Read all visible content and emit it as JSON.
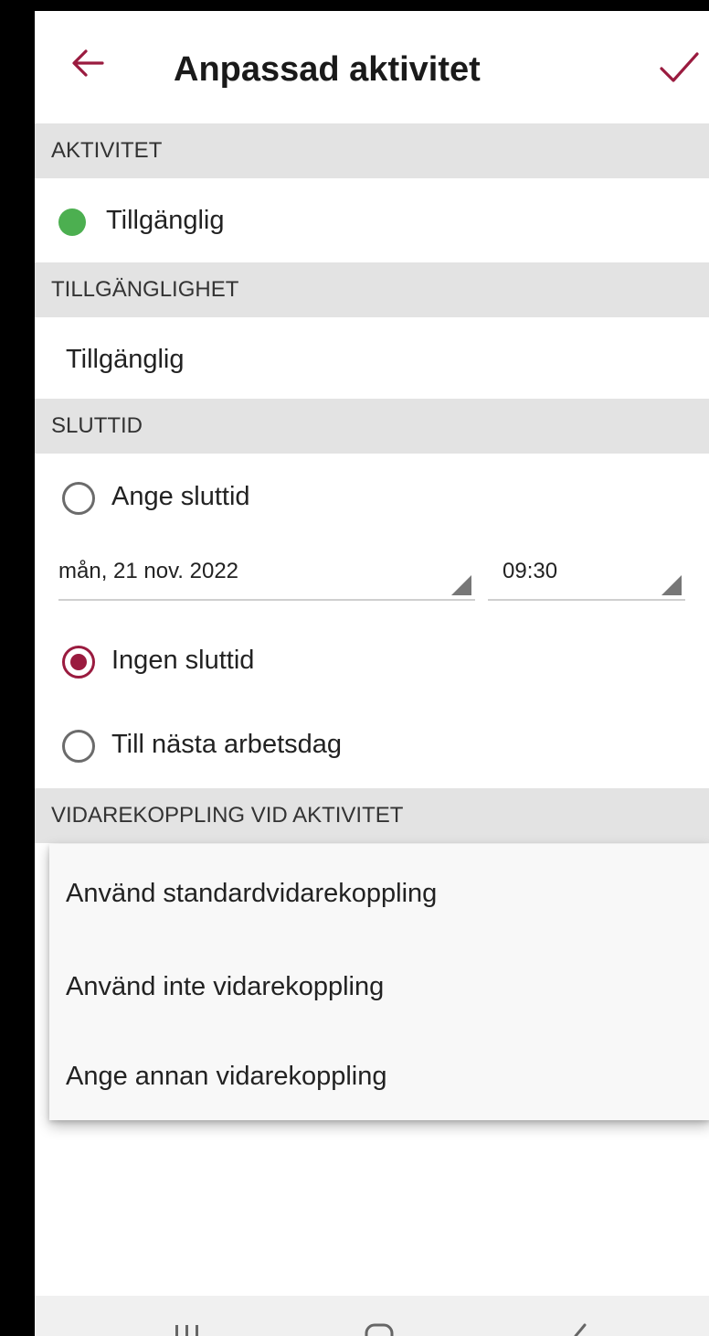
{
  "header": {
    "title": "Anpassad aktivitet",
    "back_icon": "arrow-left-icon",
    "confirm_icon": "check-icon",
    "accent_color": "#9a1b3f"
  },
  "sections": {
    "activity": {
      "header": "AKTIVITET",
      "value": "Tillgänglig",
      "status_color": "#4caf50"
    },
    "availability": {
      "header": "TILLGÄNGLIGHET",
      "value": "Tillgänglig"
    },
    "end_time": {
      "header": "SLUTTID",
      "options": [
        {
          "label": "Ange sluttid",
          "selected": false
        },
        {
          "label": "Ingen sluttid",
          "selected": true
        },
        {
          "label": "Till nästa arbetsdag",
          "selected": false
        }
      ],
      "date_value": "mån, 21 nov. 2022",
      "time_value": "09:30"
    },
    "forwarding": {
      "header": "VIDAREKOPPLING VID AKTIVITET",
      "menu_items": [
        "Använd standardvidarekoppling",
        "Använd inte vidarekoppling",
        "Ange annan vidarekoppling"
      ]
    }
  },
  "navbar": {
    "icons": [
      "recent-apps-icon",
      "home-icon",
      "back-icon"
    ]
  }
}
